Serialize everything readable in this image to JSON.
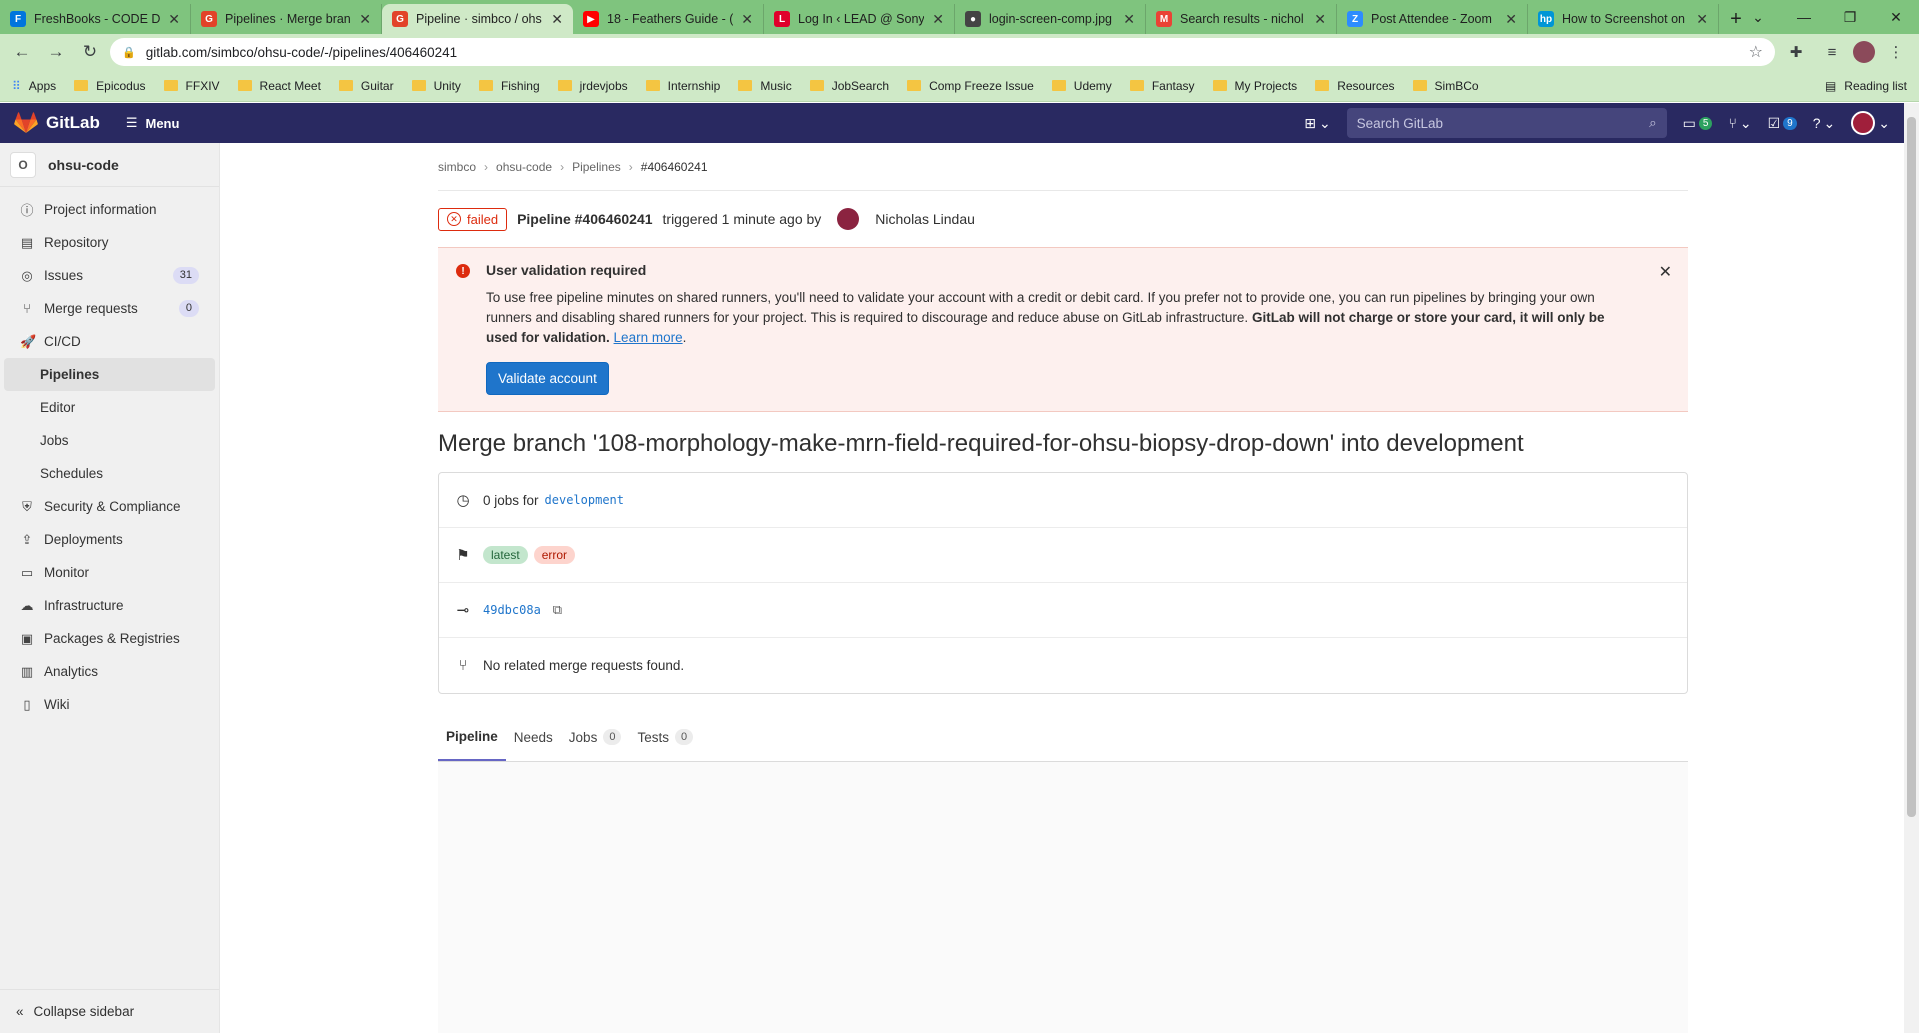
{
  "browser": {
    "tabs": [
      {
        "title": "FreshBooks - CODE De",
        "fav": "F",
        "color": "#0075dd"
      },
      {
        "title": "Pipelines · Merge bran",
        "fav": "G",
        "color": "#e24329"
      },
      {
        "title": "Pipeline · simbco / ohs",
        "fav": "G",
        "color": "#e24329",
        "active": true
      },
      {
        "title": "18 - Feathers Guide - (",
        "fav": "▶",
        "color": "#ff0000"
      },
      {
        "title": "Log In ‹ LEAD @ Sony",
        "fav": "L",
        "color": "#e0002b"
      },
      {
        "title": "login-screen-comp.jpg",
        "fav": "●",
        "color": "#444444"
      },
      {
        "title": "Search results - nichol",
        "fav": "M",
        "color": "#ea4335"
      },
      {
        "title": "Post Attendee - Zoom",
        "fav": "Z",
        "color": "#2d8cff"
      },
      {
        "title": "How to Screenshot on",
        "fav": "hp",
        "color": "#0096d6"
      }
    ],
    "url": "gitlab.com/simbco/ohsu-code/-/pipelines/406460241",
    "bookmarks": [
      "Apps",
      "Epicodus",
      "FFXIV",
      "React Meet",
      "Guitar",
      "Unity",
      "Fishing",
      "jrdevjobs",
      "Internship",
      "Music",
      "JobSearch",
      "Comp Freeze Issue",
      "Udemy",
      "Fantasy",
      "My Projects",
      "Resources",
      "SimBCo"
    ],
    "reading_list": "Reading list"
  },
  "header": {
    "brand": "GitLab",
    "menu": "Menu",
    "search_placeholder": "Search GitLab",
    "issues_count": "5",
    "todos_count": "9"
  },
  "sidebar": {
    "project_initial": "O",
    "project_name": "ohsu-code",
    "items": [
      {
        "label": "Project information",
        "icon": "ⓘ"
      },
      {
        "label": "Repository",
        "icon": "▤"
      },
      {
        "label": "Issues",
        "icon": "◎",
        "count": "31"
      },
      {
        "label": "Merge requests",
        "icon": "⑂",
        "count": "0"
      },
      {
        "label": "CI/CD",
        "icon": "🚀"
      }
    ],
    "cicd_sub": [
      "Pipelines",
      "Editor",
      "Jobs",
      "Schedules"
    ],
    "items_after": [
      {
        "label": "Security & Compliance",
        "icon": "⛨"
      },
      {
        "label": "Deployments",
        "icon": "⇪"
      },
      {
        "label": "Monitor",
        "icon": "▭"
      },
      {
        "label": "Infrastructure",
        "icon": "☁"
      },
      {
        "label": "Packages & Registries",
        "icon": "▣"
      },
      {
        "label": "Analytics",
        "icon": "▥"
      },
      {
        "label": "Wiki",
        "icon": "▯"
      }
    ],
    "collapse": "Collapse sidebar"
  },
  "breadcrumb": [
    "simbco",
    "ohsu-code",
    "Pipelines",
    "#406460241"
  ],
  "pipeline": {
    "status": "failed",
    "id_label": "Pipeline #406460241",
    "triggered": "triggered 1 minute ago by",
    "user": "Nicholas Lindau"
  },
  "alert": {
    "title": "User validation required",
    "body": "To use free pipeline minutes on shared runners, you'll need to validate your account with a credit or debit card. If you prefer not to provide one, you can run pipelines by bringing your own runners and disabling shared runners for your project. This is required to discourage and reduce abuse on GitLab infrastructure.",
    "bold": "GitLab will not charge or store your card, it will only be used for validation.",
    "link": "Learn more",
    "button": "Validate account"
  },
  "commit_title": "Merge branch '108-morphology-make-mrn-field-required-for-ohsu-biopsy-drop-down' into development",
  "info": {
    "jobs_text": "0 jobs for",
    "branch": "development",
    "badge_latest": "latest",
    "badge_error": "error",
    "sha": "49dbc08a",
    "mr_text": "No related merge requests found."
  },
  "tabs": [
    {
      "label": "Pipeline",
      "active": true
    },
    {
      "label": "Needs"
    },
    {
      "label": "Jobs",
      "count": "0"
    },
    {
      "label": "Tests",
      "count": "0"
    }
  ]
}
